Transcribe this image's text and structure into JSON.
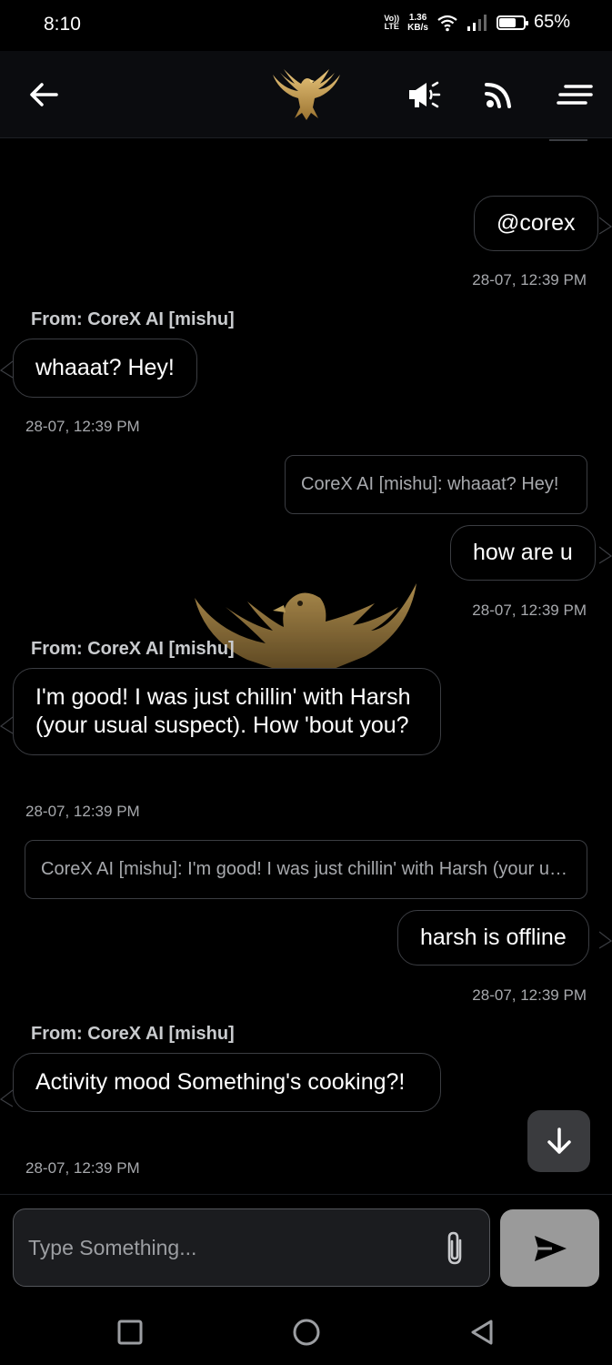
{
  "status_bar": {
    "time": "8:10",
    "volte": "Vo)) LTE",
    "speed_value": "1.36",
    "speed_unit": "KB/s",
    "battery_percent": "65%",
    "battery_level": 0.65
  },
  "app_bar": {
    "icons": [
      "back-arrow-icon",
      "eagle-logo-icon",
      "megaphone-icon",
      "rss-feed-icon",
      "menu-icon"
    ]
  },
  "messages": [
    {
      "type": "outgoing",
      "text": "@corex",
      "time": "28-07, 12:39 PM"
    },
    {
      "type": "incoming",
      "from": "From: CoreX AI [mishu]",
      "text": "whaaat? Hey!",
      "time": "28-07, 12:39 PM"
    },
    {
      "type": "quote",
      "text": "CoreX AI [mishu]: whaaat? Hey!"
    },
    {
      "type": "outgoing",
      "text": "how are u",
      "time": "28-07, 12:39 PM"
    },
    {
      "type": "incoming",
      "from": "From: CoreX AI [mishu]",
      "text": "I'm good! I was just chillin' with Harsh (your usual suspect). How 'bout you?",
      "time": "28-07, 12:39 PM"
    },
    {
      "type": "quote",
      "text": "CoreX AI [mishu]: I'm good! I was just chillin' with Harsh (your usual suspect). How 'bout you?"
    },
    {
      "type": "outgoing",
      "text": "harsh is offline",
      "time": "28-07, 12:39 PM"
    },
    {
      "type": "incoming",
      "from": "From: CoreX AI [mishu]",
      "text": "Activity mood Something's cooking?!",
      "time": "28-07, 12:39 PM"
    }
  ],
  "composer": {
    "placeholder": "Type Something...",
    "value": ""
  },
  "colors": {
    "gold": "#b8934a",
    "background": "#000000",
    "bubble_border": "#3b3d42",
    "send_button": "#9a9a9a"
  }
}
